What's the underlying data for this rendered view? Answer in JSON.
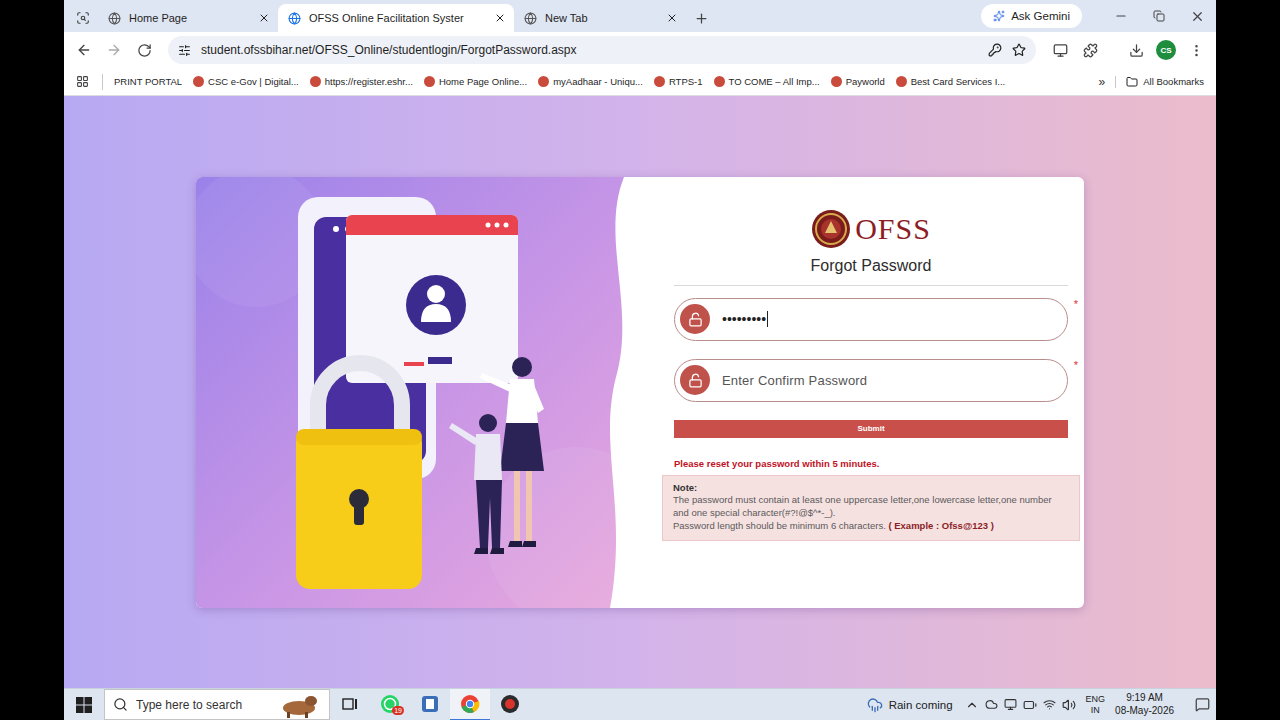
{
  "browser": {
    "tabs": [
      {
        "label": "Home Page",
        "selected": false
      },
      {
        "label": "OFSS Online Facilitation Syster",
        "selected": true
      },
      {
        "label": "New Tab",
        "selected": false
      }
    ],
    "ask_gemini": "Ask Gemini",
    "url": "student.ofssbihar.net/OFSS_Online/studentlogin/ForgotPassword.aspx",
    "profile": "CS",
    "bookmarks": [
      "PRINT PORTAL",
      "CSC e-Gov | Digital...",
      "https://register.eshr...",
      "Home Page Online...",
      "myAadhaar - Uniqu...",
      "RTPS-1",
      "TO COME – All Imp...",
      "Payworld",
      "Best Card Services I..."
    ],
    "bookmarks_more": "»",
    "all_bookmarks": "All Bookmarks"
  },
  "page": {
    "logo": "OFSS",
    "heading": "Forgot Password",
    "fields": [
      {
        "kind": "value",
        "text": "•••••••••",
        "focused": true
      },
      {
        "kind": "placeholder",
        "text": "Enter Confirm Password",
        "focused": false
      }
    ],
    "required_mark": "*",
    "submit": "Submit",
    "warning": "Please reset your password within 5 minutes.",
    "note": {
      "title": "Note:",
      "text": "The password must contain at least one uppercase letter,one lowercase letter,one number and one special character(#?!@$^*-_).",
      "length_rule": "Password length should be minimum 6 characters.",
      "example": "( Example : Ofss@123 )"
    }
  },
  "taskbar": {
    "search_placeholder": "Type here to search",
    "apps": [
      {
        "kind": "taskview",
        "badge": "",
        "active": false
      },
      {
        "kind": "whatsapp",
        "badge": "19",
        "active": false
      },
      {
        "kind": "app",
        "badge": "",
        "active": false
      },
      {
        "kind": "chrome",
        "badge": "",
        "active": true
      },
      {
        "kind": "app2",
        "badge": "",
        "active": false
      }
    ],
    "weather": "Rain coming",
    "language": "ENG",
    "region": "IN",
    "time": "9:19 AM",
    "date": "08-May-2026"
  }
}
